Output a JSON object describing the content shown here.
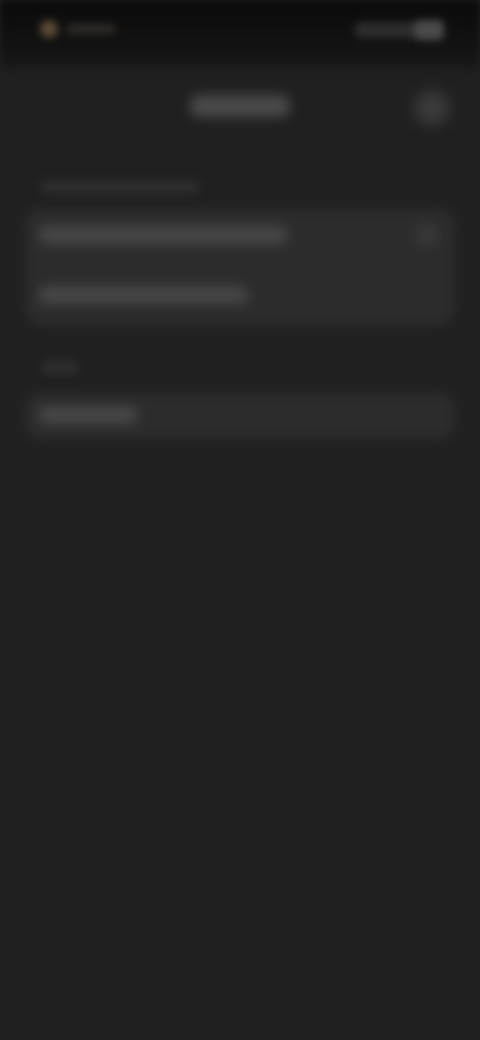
{
  "app": {
    "title": ""
  },
  "status_bar": {
    "icons": [
      "app-indicator-icon",
      "signal-icon",
      "battery-icon"
    ]
  },
  "header": {
    "title": "",
    "action_icon": "more-icon"
  },
  "sections": [
    {
      "label": "",
      "rows": [
        {
          "label": "",
          "trailing_icon": "chevron-right-icon"
        },
        {
          "label": ""
        }
      ]
    },
    {
      "label": "",
      "rows": [
        {
          "label": ""
        }
      ]
    }
  ],
  "colors": {
    "background": "#202020",
    "card": "#2c2c2c",
    "status_bar": "#0a0a0a",
    "accent": "#5a4a35"
  }
}
